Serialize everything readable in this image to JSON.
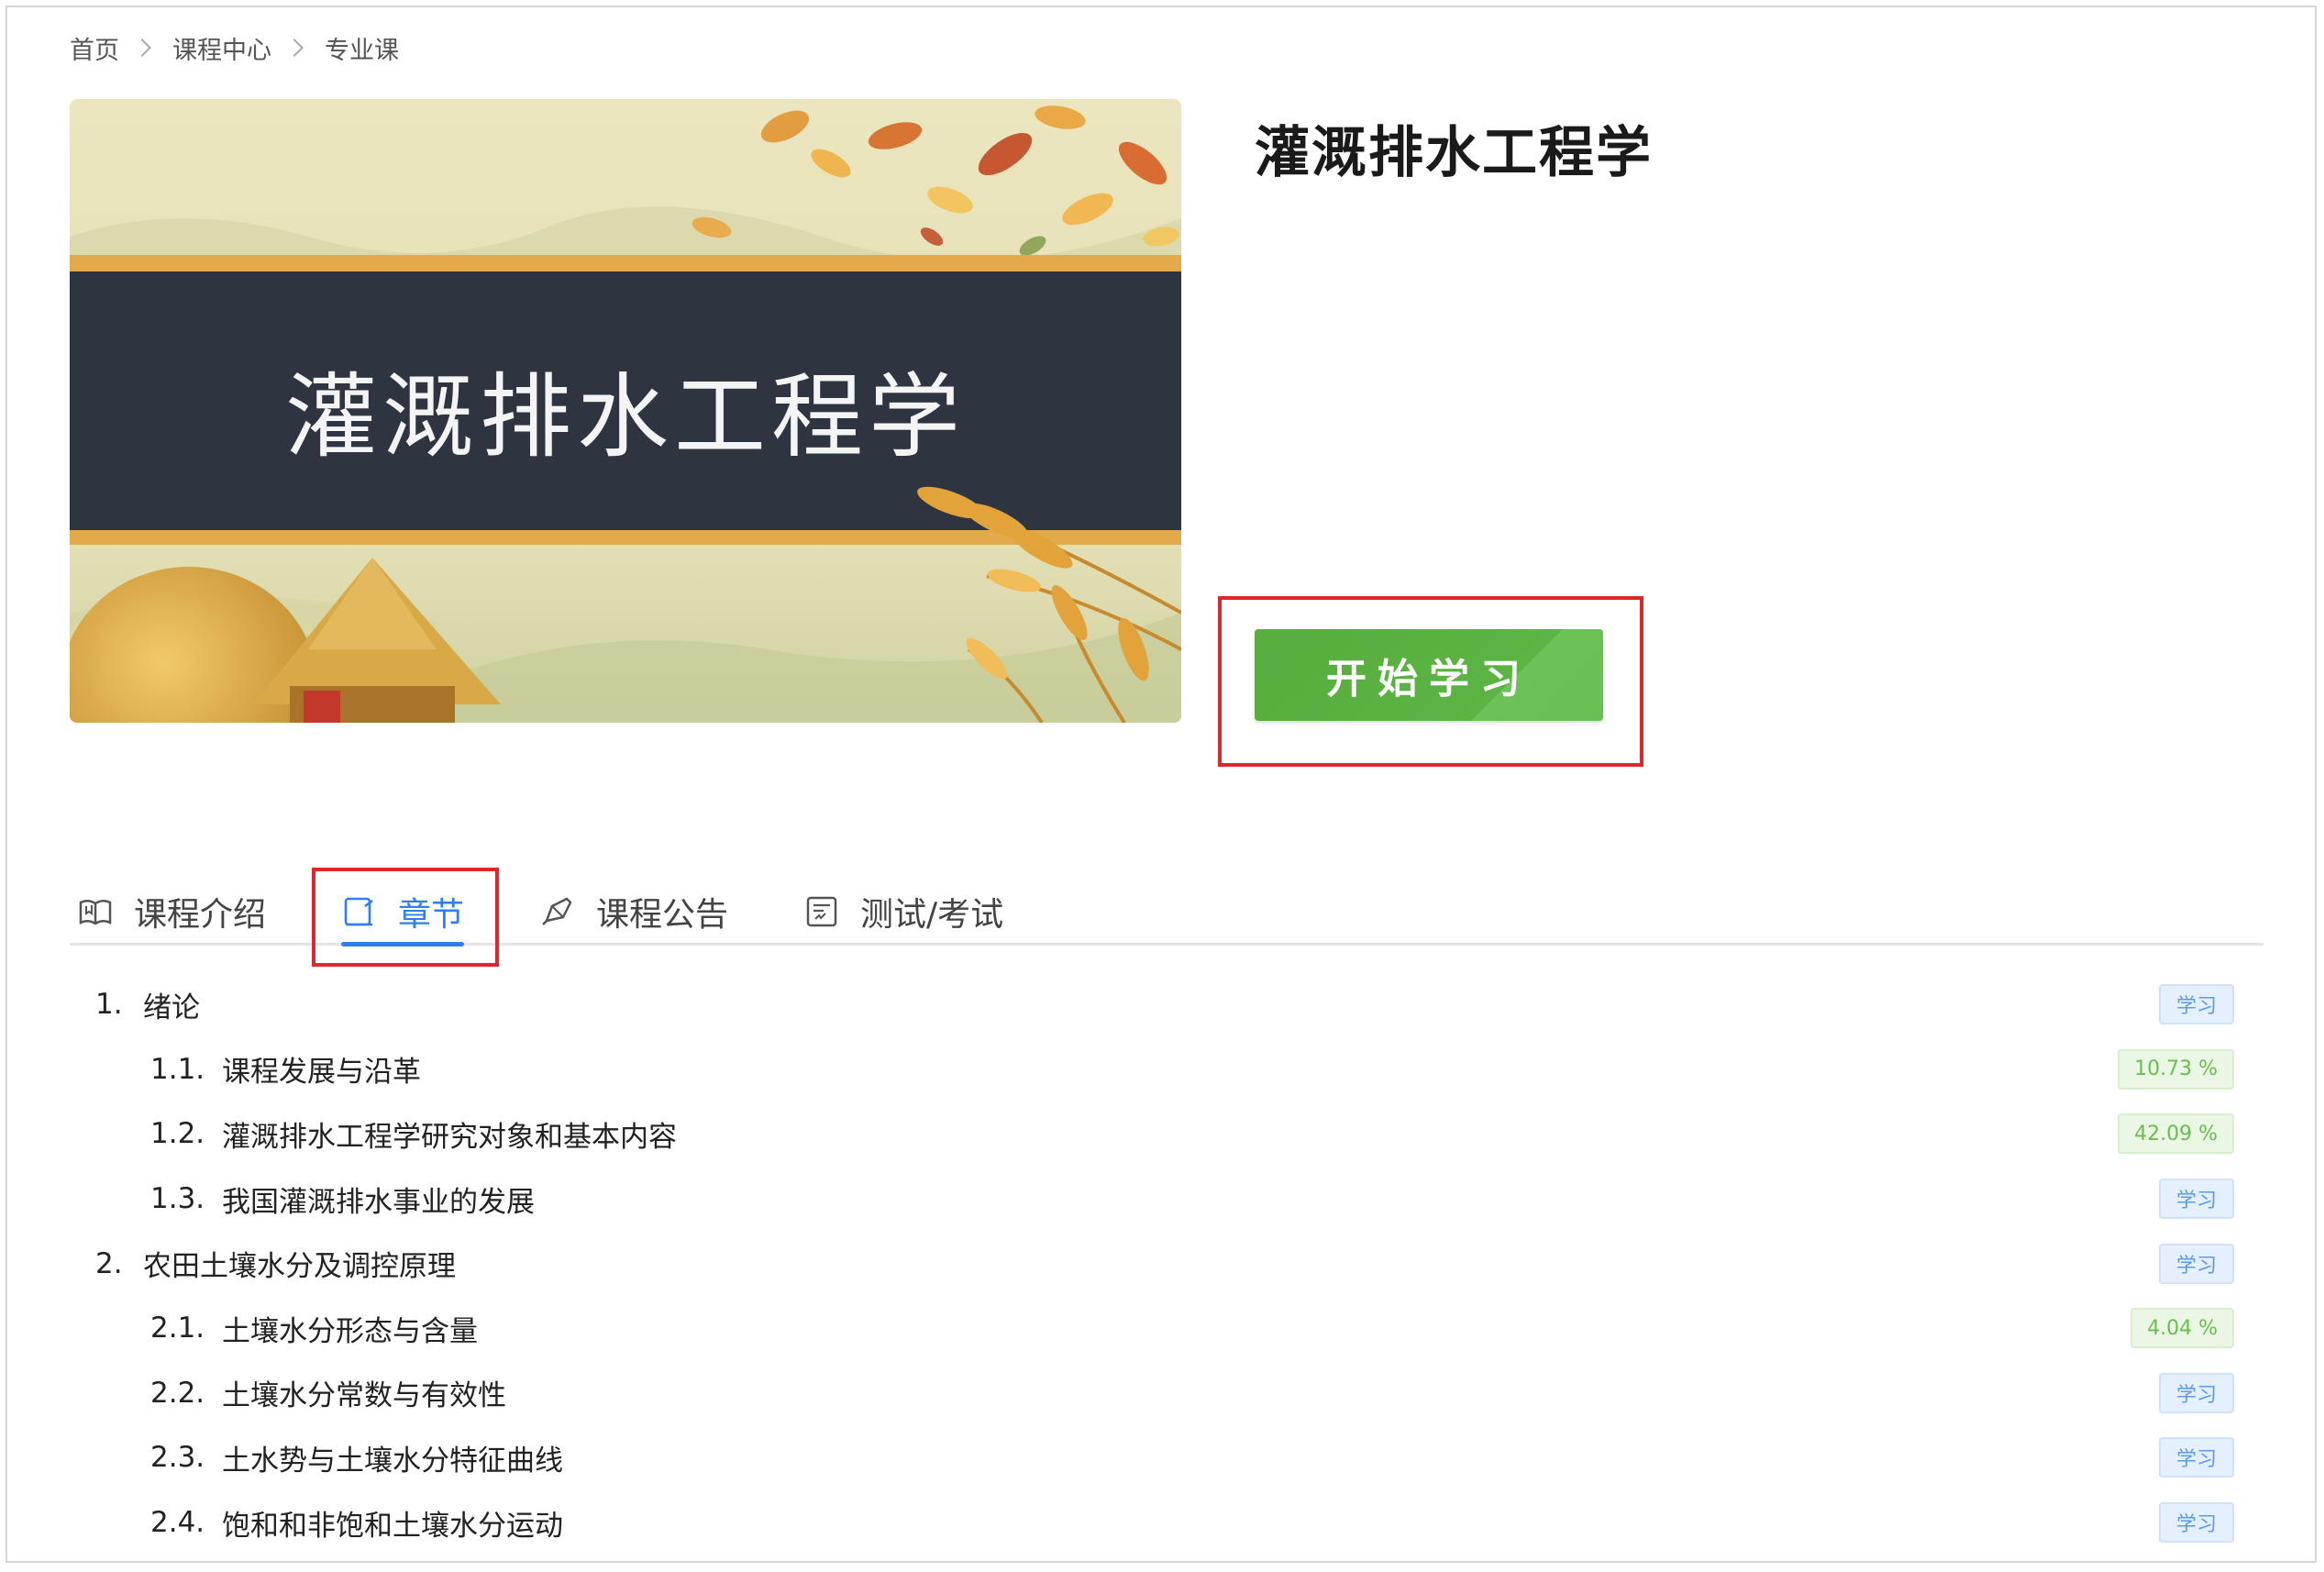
{
  "breadcrumb": {
    "items": [
      "首页",
      "课程中心",
      "专业课"
    ]
  },
  "cover": {
    "title": "灌溉排水工程学"
  },
  "course": {
    "title": "灌溉排水工程学",
    "start_label": "开始学习"
  },
  "tabs": [
    {
      "label": "课程介绍",
      "icon": "book-icon"
    },
    {
      "label": "章节",
      "icon": "chapter-icon",
      "active": true
    },
    {
      "label": "课程公告",
      "icon": "megaphone-icon"
    },
    {
      "label": "测试/考试",
      "icon": "exam-icon"
    }
  ],
  "chapters": [
    {
      "num": "1.",
      "title": "绪论",
      "level": 1,
      "status": "学习"
    },
    {
      "num": "1.1.",
      "title": "课程发展与沿革",
      "level": 2,
      "status": "10.73 %"
    },
    {
      "num": "1.2.",
      "title": "灌溉排水工程学研究对象和基本内容",
      "level": 2,
      "status": "42.09 %"
    },
    {
      "num": "1.3.",
      "title": "我国灌溉排水事业的发展",
      "level": 2,
      "status": "学习"
    },
    {
      "num": "2.",
      "title": "农田土壤水分及调控原理",
      "level": 1,
      "status": "学习"
    },
    {
      "num": "2.1.",
      "title": "土壤水分形态与含量",
      "level": 2,
      "status": "4.04 %"
    },
    {
      "num": "2.2.",
      "title": "土壤水分常数与有效性",
      "level": 2,
      "status": "学习"
    },
    {
      "num": "2.3.",
      "title": "土水势与土壤水分特征曲线",
      "level": 2,
      "status": "学习"
    },
    {
      "num": "2.4.",
      "title": "饱和和非饱和土壤水分运动",
      "level": 2,
      "status": "学习"
    }
  ],
  "colors": {
    "accent": "#2f7ff0",
    "start_button": "#5bb443",
    "highlight": "#e0262b",
    "progress_text": "#6bbd4e",
    "learn_text": "#5b9bef"
  }
}
